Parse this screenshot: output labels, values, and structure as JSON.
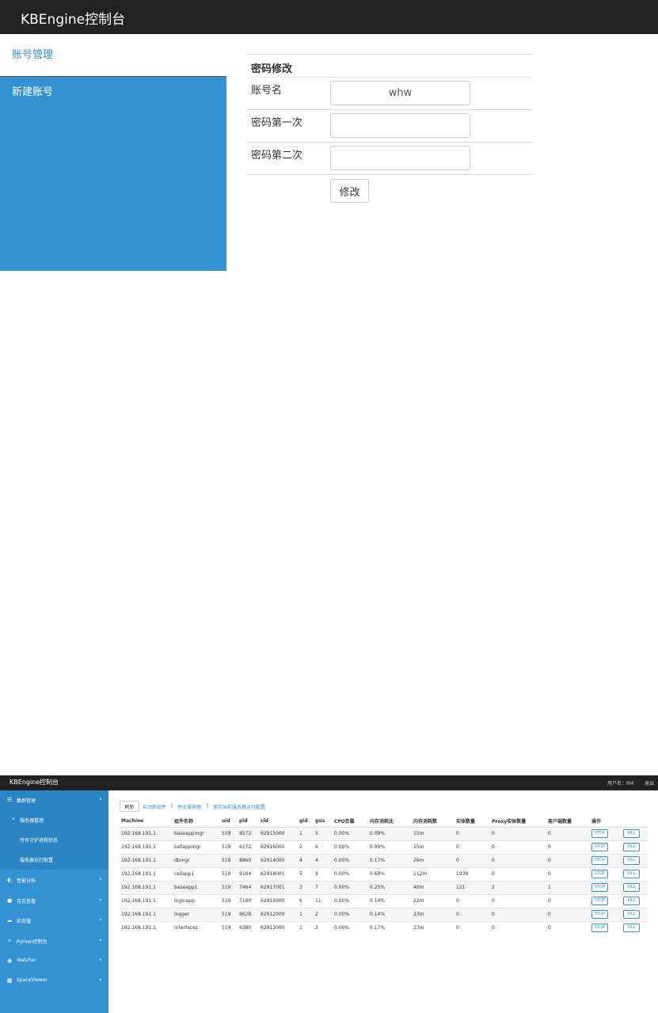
{
  "top": {
    "brand": "KBEngine控制台",
    "nav": [
      {
        "label": "账号管理",
        "active": true
      },
      {
        "label": "新建账号",
        "active": false
      }
    ],
    "form": {
      "heading": "密码修改",
      "account_label": "账号名",
      "account_value": "whw",
      "password1_label": "密码第一次",
      "password1_value": "",
      "password2_label": "密码第二次",
      "password2_value": "",
      "submit_label": "修改"
    }
  },
  "bottom": {
    "brand": "KBEngine控制台",
    "user": "用户名：RM",
    "logout": "退出",
    "nav": [
      {
        "label": "集群管理",
        "icon": "server-icon",
        "arrow": "▸"
      },
      {
        "label": "服务器管理",
        "sub": true,
        "bullet": "▸"
      },
      {
        "label": "所有守护进程状态",
        "sub": true
      },
      {
        "label": "服务器运行配置",
        "sub": true
      },
      {
        "label": "性能分析",
        "icon": "chart-icon",
        "arrow": "▸"
      },
      {
        "label": "日志查看",
        "icon": "log-icon",
        "arrow": "▸"
      },
      {
        "label": "状态值",
        "icon": "cloud-icon",
        "arrow": "▸"
      },
      {
        "label": "Python控制台",
        "icon": "console-icon",
        "arrow": "▸"
      },
      {
        "label": "Watcher",
        "icon": "eye-icon",
        "arrow": "▸"
      },
      {
        "label": "SpaceViewer",
        "icon": "map-icon",
        "arrow": "▸"
      }
    ],
    "toolbar": {
      "refresh": "刷新",
      "start": "启动新组件",
      "sep1": "|",
      "stop": "停止服务器",
      "sep2": "|",
      "save": "保存当前服务器运行配置"
    },
    "table": {
      "headers": [
        "Machine",
        "组件名称",
        "uid",
        "pid",
        "cid",
        "gid",
        "gus",
        "CPU负载",
        "内存消耗比",
        "内存消耗数",
        "实体数量",
        "Proxy实体数量",
        "客户端数量",
        "操作",
        ""
      ],
      "stop_label": "STOP",
      "kill_label": "KILL",
      "rows": [
        [
          "192.168.191.1",
          "baseappmgr",
          "519",
          "8572",
          "62915000",
          "1",
          "5",
          "0.00%",
          "0.09%",
          "15m",
          "0",
          "0",
          "0"
        ],
        [
          "192.168.191.1",
          "cellappmgr",
          "519",
          "6172",
          "62916000",
          "2",
          "6",
          "0.00%",
          "0.09%",
          "15m",
          "0",
          "0",
          "0"
        ],
        [
          "192.168.191.1",
          "dbmgr",
          "519",
          "8860",
          "62914000",
          "4",
          "4",
          "0.00%",
          "0.17%",
          "26m",
          "0",
          "0",
          "0"
        ],
        [
          "192.168.191.1",
          "cellapp1",
          "519",
          "9164",
          "62918001",
          "5",
          "9",
          "0.00%",
          "0.69%",
          "112m",
          "1939",
          "0",
          "0"
        ],
        [
          "192.168.191.1",
          "baseapp1",
          "519",
          "7464",
          "62917001",
          "3",
          "7",
          "0.00%",
          "0.25%",
          "40m",
          "121",
          "2",
          "1"
        ],
        [
          "192.168.191.1",
          "loginapp",
          "519",
          "7180",
          "62919000",
          "6",
          "11",
          "0.00%",
          "0.14%",
          "22m",
          "0",
          "0",
          "0"
        ],
        [
          "192.168.191.1",
          "logger",
          "519",
          "8628",
          "62912000",
          "1",
          "2",
          "0.00%",
          "0.14%",
          "23m",
          "0",
          "0",
          "0"
        ],
        [
          "192.168.191.1",
          "interfaces",
          "519",
          "6380",
          "62913000",
          "1",
          "3",
          "0.00%",
          "0.17%",
          "27m",
          "0",
          "0",
          "0"
        ]
      ]
    }
  }
}
